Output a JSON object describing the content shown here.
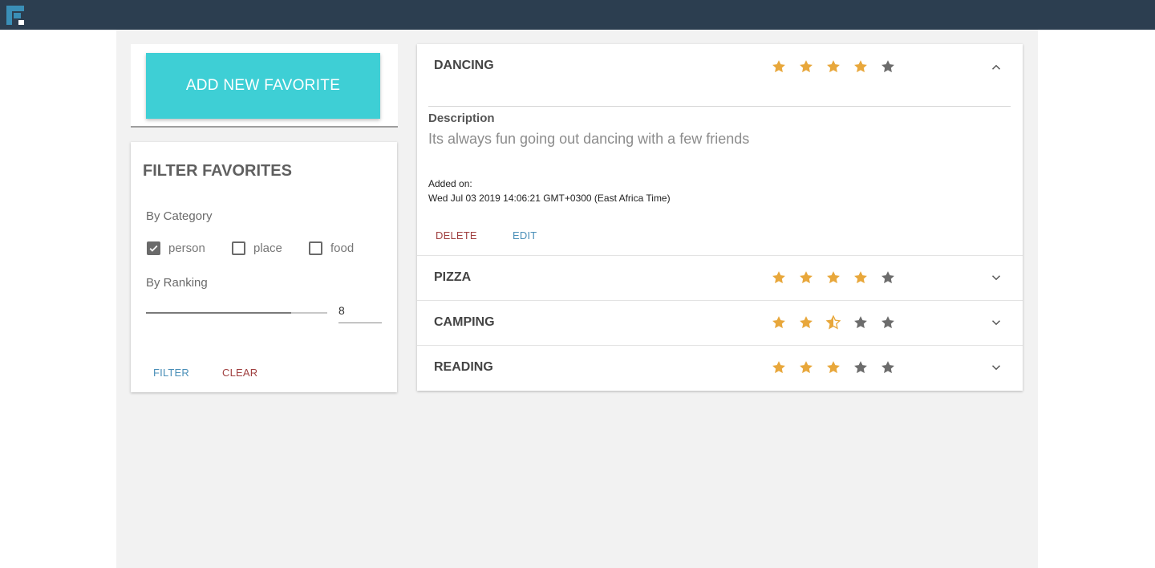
{
  "colors": {
    "topbar": "#2c3e50",
    "accent": "#3ecfd5",
    "star_filled": "#e8a73b",
    "star_empty": "#6c6c6c",
    "danger": "#a04040",
    "link": "#4a8fb8"
  },
  "header": {
    "logo_icon": "app-logo"
  },
  "sidebar": {
    "add_button_label": "ADD NEW FAVORITE",
    "filter": {
      "title": "FILTER FAVORITES",
      "by_category_label": "By Category",
      "categories": [
        {
          "label": "person",
          "checked": true
        },
        {
          "label": "place",
          "checked": false
        },
        {
          "label": "food",
          "checked": false
        }
      ],
      "by_ranking_label": "By Ranking",
      "ranking_value": "8",
      "ranking_fraction": 0.8,
      "filter_button": "FILTER",
      "clear_button": "CLEAR"
    }
  },
  "favorites": [
    {
      "title": "DANCING",
      "rating": 4,
      "expanded": true,
      "description_label": "Description",
      "description": "Its always fun going out dancing with a few friends",
      "added_label": "Added on:",
      "added_date": "Wed Jul 03 2019 14:06:21 GMT+0300 (East Africa Time)",
      "delete_button": "DELETE",
      "edit_button": "EDIT"
    },
    {
      "title": "PIZZA",
      "rating": 4,
      "expanded": false
    },
    {
      "title": "CAMPING",
      "rating": 2.5,
      "expanded": false
    },
    {
      "title": "READING",
      "rating": 3,
      "expanded": false
    }
  ]
}
